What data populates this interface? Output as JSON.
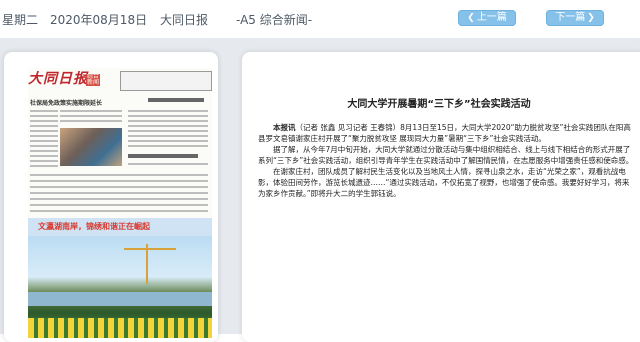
{
  "topbar": {
    "weekday": "星期二",
    "date": "2020年08月18日",
    "paper_name": "大同日报",
    "section": "-A5 综合新闻-",
    "prev_label": "上一篇",
    "next_label": "下一篇"
  },
  "thumbnail": {
    "masthead": "大同日报",
    "tag": "综合新闻",
    "headline": "社保局免政策实施期限延长",
    "feature_headline": "文瀛湖南岸，锦绣和谐正在崛起"
  },
  "article": {
    "title": "大同大学开展暑期“三下乡”社会实践活动",
    "paragraphs": [
      {
        "lead": "本报讯",
        "text": "（记者  张鑫  见习记者  王春锦）8月13日至15日，大同大学2020“助力脱贫攻坚”社会实践团队在阳高县罗文皂镇谢家庄村开展了“聚力脱贫攻坚 展现同大力量”暑期“三下乡”社会实践活动。"
      },
      {
        "lead": "",
        "text": "据了解，从今年7月中旬开始，大同大学就通过分散活动与集中组织相结合、线上与线下相结合的形式开展了系列“三下乡”社会实践活动，组织引导青年学生在实践活动中了解国情民情，在志愿服务中增强责任感和使命感。"
      },
      {
        "lead": "",
        "text": "在谢家庄村，团队成员了解村民生活变化以及当地风土人情，探寻山泉之水，走访“光荣之家”，观看抗战电影，体验田间劳作，游览长城遗迹……“通过实践活动，不仅拓宽了视野，也增强了使命感。我要好好学习，将来为家乡作贡献。”即将升大二的学生郭钰说。"
      }
    ]
  },
  "colors": {
    "button_bg": "#86c1ea",
    "masthead_red": "#c0262b",
    "stage_bg": "#e6eaee"
  }
}
